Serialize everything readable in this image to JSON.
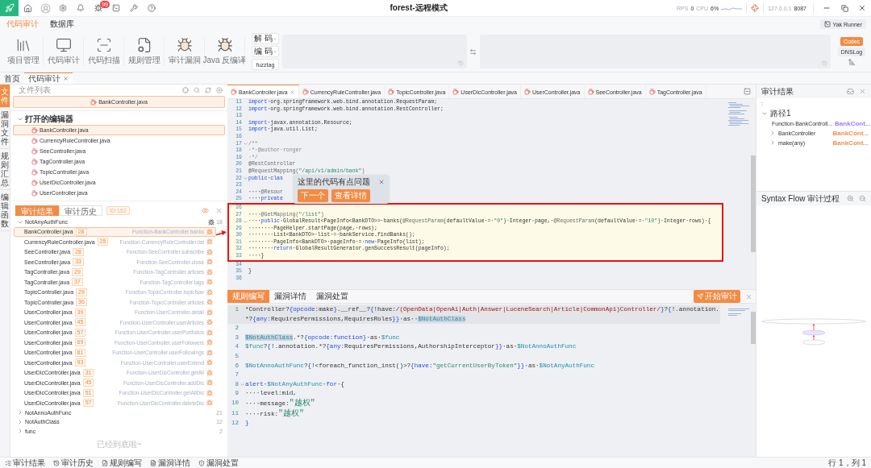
{
  "app_bar": {
    "title": "forest-远程模式",
    "notification_badge": "99",
    "rps_label": "RPS",
    "rps": "0",
    "cpu_label": "CPU",
    "cpu": "6%",
    "host": "127.0.0.1",
    "port": "8087"
  },
  "menu_tabs": [
    {
      "label": "代码审计",
      "selected": true
    },
    {
      "label": "数据库",
      "selected": false
    }
  ],
  "yak_runner": "Yak Runner",
  "tools": [
    {
      "label": "项目管理",
      "kind": "project"
    },
    {
      "label": "代码审计",
      "kind": "audit"
    },
    {
      "label": "代码扫描",
      "kind": "scan"
    },
    {
      "label": "规则管理",
      "kind": "rules"
    },
    {
      "label": "审计漏洞",
      "kind": "vuln"
    },
    {
      "label": "Java 反编译",
      "kind": "decompile"
    }
  ],
  "codec": {
    "decode": "解 码",
    "encode": "编 码",
    "fuzztag": "fuzztag"
  },
  "side_tools": [
    {
      "label": "Codec",
      "selected": true
    },
    {
      "label": "DNSLog",
      "selected": false
    }
  ],
  "page_tabs": [
    {
      "label": "首页",
      "selected": false,
      "closable": false
    },
    {
      "label": "代码审计",
      "selected": true,
      "closable": true
    }
  ],
  "side_rail": [
    {
      "label": "文件",
      "selected": true
    },
    {
      "label": "漏洞文件",
      "selected": false
    },
    {
      "label": "规则汇总",
      "selected": false
    },
    {
      "label": "编辑函数",
      "selected": false
    }
  ],
  "file_list": {
    "title": "文件列表",
    "current": "BankController.java",
    "open_editors": {
      "title": "打开的编辑器",
      "expanded": true,
      "files": [
        {
          "name": "BankController.java",
          "selected": true
        },
        {
          "name": "CurrencyRuleController.java",
          "selected": false
        },
        {
          "name": "SeeController.java",
          "selected": false
        },
        {
          "name": "TagController.java",
          "selected": false
        },
        {
          "name": "TopicController.java",
          "selected": false
        },
        {
          "name": "UserDicController.java",
          "selected": false
        },
        {
          "name": "UserController.java",
          "selected": false
        }
      ]
    }
  },
  "results": {
    "tabs": [
      {
        "label": "审计结果",
        "selected": true
      },
      {
        "label": "审计历史",
        "selected": false
      }
    ],
    "id_badge": "ID:152",
    "groups": [
      {
        "name": "NotAnyAuthFunc",
        "count": "18",
        "expanded": true,
        "items": [
          {
            "file": "BankController.java",
            "line": "28",
            "function": "Function-BankController.banks",
            "selected": true
          },
          {
            "file": "CurrencyRuleController.java",
            "line": "25",
            "function": "Function-CurrencyRuleController.list",
            "selected": false
          },
          {
            "file": "SeeController.java",
            "line": "28",
            "function": "Function-SeeController.subscribe",
            "selected": false
          },
          {
            "file": "SeeController.java",
            "line": "33",
            "function": "Function-SeeController.close",
            "selected": false
          },
          {
            "file": "TagController.java",
            "line": "29",
            "function": "Function-TagController.articles",
            "selected": false
          },
          {
            "file": "TagController.java",
            "line": "37",
            "function": "Function-TagController.tags",
            "selected": false
          },
          {
            "file": "TopicController.java",
            "line": "29",
            "function": "Function-TopicController.topicNav",
            "selected": false
          },
          {
            "file": "TopicController.java",
            "line": "36",
            "function": "Function-TopicController.articles",
            "selected": false
          },
          {
            "file": "UserController.java",
            "line": "39",
            "function": "Function-UserController.detail",
            "selected": false
          },
          {
            "file": "UserController.java",
            "line": "45",
            "function": "Function-UserController.userArticles",
            "selected": false
          },
          {
            "file": "UserController.java",
            "line": "57",
            "function": "Function-UserController.userPortfolios",
            "selected": false
          },
          {
            "file": "UserController.java",
            "line": "69",
            "function": "Function-UserController.userFollowers",
            "selected": false
          },
          {
            "file": "UserController.java",
            "line": "81",
            "function": "Function-UserController.userFollowings",
            "selected": false
          },
          {
            "file": "UserController.java",
            "line": "93",
            "function": "Function-UserController.userExtend",
            "selected": false
          },
          {
            "file": "UserDicController.java",
            "line": "31",
            "function": "Function-UserDicController.getAll",
            "selected": false
          },
          {
            "file": "UserDicController.java",
            "line": "45",
            "function": "Function-UserDicController.addDic",
            "selected": false
          },
          {
            "file": "UserDicController.java",
            "line": "51",
            "function": "Function-UserDicController.getAllDic",
            "selected": false
          },
          {
            "file": "UserDicController.java",
            "line": "57",
            "function": "Function-UserDicController.deleteDic",
            "selected": false
          }
        ]
      },
      {
        "name": "NotAnnoAuthFunc",
        "count": "21",
        "expanded": false
      },
      {
        "name": "NotAuthClass",
        "count": "12",
        "expanded": false
      },
      {
        "name": "func",
        "count": "2",
        "expanded": false
      }
    ],
    "end_text": "已经到底啦~"
  },
  "editor": {
    "tabs": [
      {
        "label": "BankController.java",
        "selected": true
      },
      {
        "label": "CurrencyRuleController.java",
        "selected": false
      },
      {
        "label": "TopicController.java",
        "selected": false
      },
      {
        "label": "UserDicController.java",
        "selected": false
      },
      {
        "label": "UserController.java",
        "selected": false
      },
      {
        "label": "SeeController.java",
        "selected": false
      },
      {
        "label": "TagController.java",
        "selected": false
      }
    ],
    "popup": {
      "message": "这里的代码有点问题",
      "buttons": [
        "下一个",
        "查看详情"
      ]
    },
    "blocks": [
      {
        "boxed": false,
        "lines": [
          {
            "n": "11",
            "segs": [
              {
                "kind": "kw",
                "text": "import"
              },
              {
                "kind": "pl",
                "text": "·org.springframework.web.bind.annotation.RequestParam;"
              }
            ]
          },
          {
            "n": "12",
            "segs": [
              {
                "kind": "kw",
                "text": "import"
              },
              {
                "kind": "pl",
                "text": "·org.springframework.web.bind.annotation.RestController;"
              }
            ]
          },
          {
            "n": "13"
          },
          {
            "n": "14",
            "segs": [
              {
                "kind": "kw",
                "text": "import"
              },
              {
                "kind": "pl",
                "text": "·javax.annotation.Resource;"
              }
            ]
          },
          {
            "n": "15",
            "segs": [
              {
                "kind": "kw",
                "text": "import"
              },
              {
                "kind": "pl",
                "text": "·java.util.List;"
              }
            ]
          },
          {
            "n": "16"
          },
          {
            "n": "17",
            "fold": true,
            "segs": [
              {
                "kind": "cm",
                "text": "/**"
              }
            ]
          },
          {
            "n": "18",
            "segs": [
              {
                "kind": "cm",
                "text": "·*·@author·ronger"
              }
            ]
          },
          {
            "n": "19",
            "segs": [
              {
                "kind": "cm",
                "text": "·*/"
              }
            ]
          },
          {
            "n": "20",
            "segs": [
              {
                "kind": "an",
                "text": "@RestController"
              }
            ]
          },
          {
            "n": "21",
            "segs": [
              {
                "kind": "an",
                "text": "@RequestMapping("
              },
              {
                "kind": "st",
                "text": "\"/api/v1/admin/bank\""
              },
              {
                "kind": "an",
                "text": ")"
              }
            ]
          },
          {
            "n": "22",
            "fold": true,
            "segs": [
              {
                "kind": "kw",
                "text": "public"
              },
              {
                "kind": "pl",
                "text": "·"
              },
              {
                "kind": "kw",
                "text": "clas"
              }
            ]
          },
          {
            "n": "23"
          },
          {
            "n": "24",
            "segs": [
              {
                "kind": "pl",
                "text": "····"
              },
              {
                "kind": "an",
                "text": "@Resour"
              }
            ]
          },
          {
            "n": "25",
            "segs": [
              {
                "kind": "pl",
                "text": "····"
              },
              {
                "kind": "kw",
                "text": "private"
              }
            ]
          }
        ]
      },
      {
        "boxed": true,
        "lines": [
          {
            "n": "26"
          },
          {
            "n": "27",
            "segs": [
              {
                "kind": "pl",
                "text": "····"
              },
              {
                "kind": "an",
                "text": "@GetMapping("
              },
              {
                "kind": "st",
                "text": "\"/list\""
              },
              {
                "kind": "an",
                "text": ")"
              }
            ]
          },
          {
            "n": "28",
            "fold": true,
            "segs": [
              {
                "kind": "pl",
                "text": "····"
              },
              {
                "kind": "kw",
                "text": "public"
              },
              {
                "kind": "pl",
                "text": "·GlobalResult<PageInfo<BankDTO>>·banks("
              },
              {
                "kind": "an",
                "text": "@RequestParam"
              },
              {
                "kind": "pl",
                "text": "(defaultValue·=·"
              },
              {
                "kind": "st",
                "text": "\"0\""
              },
              {
                "kind": "pl",
                "text": ")·Integer·page,·"
              },
              {
                "kind": "an",
                "text": "@RequestParam"
              },
              {
                "kind": "pl",
                "text": "(defaultValue·=·"
              },
              {
                "kind": "st",
                "text": "\"10\""
              },
              {
                "kind": "pl",
                "text": ")·Integer·rows)·{"
              }
            ]
          },
          {
            "n": "29",
            "segs": [
              {
                "kind": "pl",
                "text": "········PageHelper.startPage(page,·rows);"
              }
            ]
          },
          {
            "n": "30",
            "segs": [
              {
                "kind": "pl",
                "text": "········List<BankDTO>·list·=·bankService.findBanks();"
              }
            ]
          },
          {
            "n": "31",
            "segs": [
              {
                "kind": "pl",
                "text": "········PageInfo<BankDTO>·pageInfo·=·"
              },
              {
                "kind": "kw",
                "text": "new"
              },
              {
                "kind": "pl",
                "text": "·PageInfo(list);"
              }
            ]
          },
          {
            "n": "32",
            "segs": [
              {
                "kind": "pl",
                "text": "········"
              },
              {
                "kind": "kw",
                "text": "return"
              },
              {
                "kind": "pl",
                "text": "·GlobalResultGenerator.genSuccessResult(pageInfo);"
              }
            ]
          },
          {
            "n": "33",
            "segs": [
              {
                "kind": "pl",
                "text": "····}"
              }
            ]
          }
        ]
      },
      {
        "boxed": false,
        "lines": [
          {
            "n": "34"
          },
          {
            "n": "35",
            "segs": [
              {
                "kind": "pl",
                "text": "}"
              }
            ]
          },
          {
            "n": "36"
          }
        ]
      }
    ]
  },
  "rule_editor": {
    "tabs": [
      {
        "label": "规则编写",
        "selected": true
      },
      {
        "label": "漏洞详情",
        "selected": false
      },
      {
        "label": "漏洞处置",
        "selected": false
      }
    ],
    "run_button": "开始审计",
    "lines": [
      {
        "n": "1",
        "current": true,
        "segs": [
          {
            "kind": "pl",
            "text": "*Controller?"
          },
          {
            "kind": "kw",
            "text": "{opcode:"
          },
          {
            "kind": "pl",
            "text": "make"
          },
          {
            "kind": "kw",
            "text": "}"
          },
          {
            "kind": "pl",
            "text": ".__ref__?"
          },
          {
            "kind": "kw",
            "text": "{"
          },
          {
            "kind": "pl",
            "text": "!have:/"
          },
          {
            "kind": "rx",
            "text": "(OpenData|OpenAi|Auth|Answer|LuceneSearch|Article|CommonApi)Controller/"
          },
          {
            "kind": "kw",
            "text": "}"
          },
          {
            "kind": "pl",
            "text": "?"
          },
          {
            "kind": "kw",
            "text": "{"
          },
          {
            "kind": "pl",
            "text": "!.annotation.*?"
          },
          {
            "kind": "kw",
            "text": "{any:"
          },
          {
            "kind": "pl",
            "text": "RequiresPermissions,RequiresRoles"
          },
          {
            "kind": "kw",
            "text": "}}"
          },
          {
            "kind": "pl",
            "text": "·as··"
          },
          {
            "kind": "hv",
            "text": "$NotAuthClass"
          }
        ]
      },
      {
        "n": "2"
      },
      {
        "n": "3",
        "segs": [
          {
            "kind": "hv",
            "text": "$NotAuthClass"
          },
          {
            "kind": "pl",
            "text": ".*?"
          },
          {
            "kind": "kw",
            "text": "{opcode:function}"
          },
          {
            "kind": "pl",
            "text": "·as·"
          },
          {
            "kind": "vr",
            "text": "$func"
          }
        ]
      },
      {
        "n": "4",
        "segs": [
          {
            "kind": "vr",
            "text": "$func"
          },
          {
            "kind": "pl",
            "text": "?"
          },
          {
            "kind": "kw",
            "text": "{"
          },
          {
            "kind": "pl",
            "text": "!.annotation.*?"
          },
          {
            "kind": "kw",
            "text": "{any:"
          },
          {
            "kind": "pl",
            "text": "RequiresPermissions,AuthorshipInterceptor"
          },
          {
            "kind": "kw",
            "text": "}}"
          },
          {
            "kind": "pl",
            "text": "·as·"
          },
          {
            "kind": "vr",
            "text": "$NotAnnoAuthFunc"
          }
        ]
      },
      {
        "n": "5"
      },
      {
        "n": "6",
        "segs": [
          {
            "kind": "vr",
            "text": "$NotAnnoAuthFunc"
          },
          {
            "kind": "pl",
            "text": "?"
          },
          {
            "kind": "kw",
            "text": "{"
          },
          {
            "kind": "pl",
            "text": "!<foreach_function_inst()>?"
          },
          {
            "kind": "kw",
            "text": "{have:"
          },
          {
            "kind": "st",
            "text": "\"getCurrentUserByToken\""
          },
          {
            "kind": "kw",
            "text": "}}"
          },
          {
            "kind": "pl",
            "text": "·as·"
          },
          {
            "kind": "vr",
            "text": "$NotAnyAuthFunc"
          }
        ]
      },
      {
        "n": "7"
      },
      {
        "n": "8",
        "fold": true,
        "segs": [
          {
            "kind": "kw",
            "text": "alert"
          },
          {
            "kind": "pl",
            "text": "·"
          },
          {
            "kind": "vr",
            "text": "$NotAnyAuthFunc"
          },
          {
            "kind": "pl",
            "text": "·"
          },
          {
            "kind": "kw",
            "text": "for"
          },
          {
            "kind": "pl",
            "text": "·{"
          }
        ]
      },
      {
        "n": "9",
        "segs": [
          {
            "kind": "pl",
            "text": "····level:mid,"
          }
        ]
      },
      {
        "n": "10",
        "segs": [
          {
            "kind": "pl",
            "text": "····message:"
          },
          {
            "kind": "st",
            "text": "\"越权\""
          }
        ]
      },
      {
        "n": "11",
        "segs": [
          {
            "kind": "pl",
            "text": "····risk:"
          },
          {
            "kind": "st",
            "text": "\"越权\""
          }
        ]
      },
      {
        "n": "12",
        "segs": [
          {
            "kind": "kw",
            "text": "}"
          }
        ]
      }
    ]
  },
  "audit_result": {
    "title": "审计结果",
    "note": ":",
    "path": {
      "label": "路径1",
      "expanded": true,
      "children": [
        {
          "label": "Function-BankControll...",
          "source": "BankCont...",
          "color": "#9b7cf0"
        },
        {
          "label": "BankController",
          "source": "BankCont...",
          "color": "#f28b54"
        },
        {
          "label": "make(any)",
          "source": "BankCont...",
          "color": "#f28b54"
        }
      ]
    }
  },
  "syntax_flow": {
    "title": "Syntax Flow 审计过程"
  },
  "status_bar": {
    "items": [
      {
        "label": "审计结果",
        "kind": "results"
      },
      {
        "label": "审计历史",
        "kind": "history"
      },
      {
        "label": "规则编写",
        "kind": "rules"
      },
      {
        "label": "漏洞详情",
        "kind": "details"
      },
      {
        "label": "漏洞处置",
        "kind": "handling"
      }
    ],
    "position": "行 1，列 1"
  }
}
